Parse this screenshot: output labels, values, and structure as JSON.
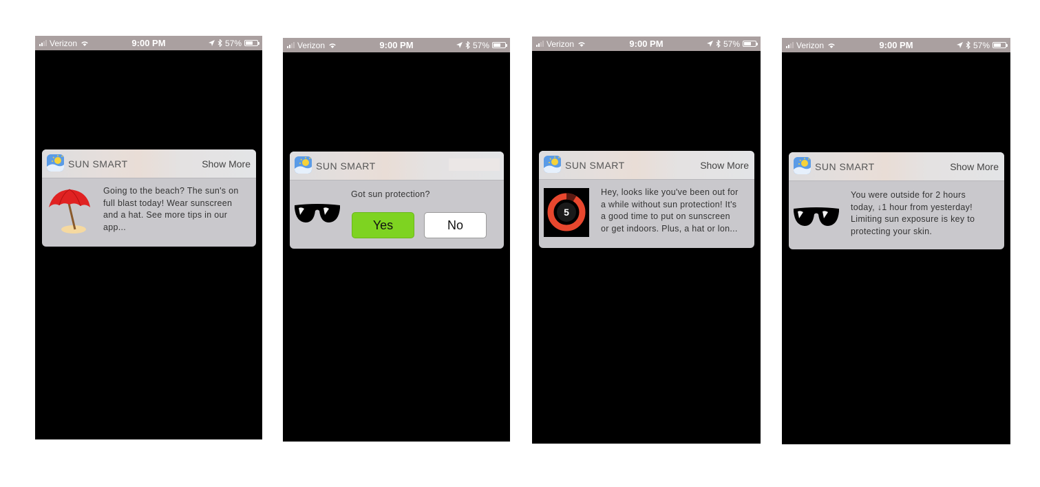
{
  "status_bar": {
    "carrier": "Verizon",
    "time": "9:00 PM",
    "battery": "57%",
    "battery_level": 0.57
  },
  "notification": {
    "app_name": "SUN SMART",
    "show_more_label": "Show More"
  },
  "screens": [
    {
      "icon": "beach-umbrella-icon",
      "message_lines": [
        "Going to the beach? The sun's on",
        "full blast today! Wear sunscreen",
        "and a hat. See more tips in our",
        "app..."
      ]
    },
    {
      "icon": "sunglasses-icon",
      "question": "Got sun protection?",
      "yes_label": "Yes",
      "no_label": "No"
    },
    {
      "icon": "countdown-ring-icon",
      "ring_value": "5",
      "message_lines": [
        "Hey, looks like you've been out for",
        "a while without sun protection! It's",
        "a good time to put on sunscreen",
        "or get indoors. Plus, a hat or lon..."
      ]
    },
    {
      "icon": "sunglasses-icon",
      "message_lines": [
        "You were outside for 2 hours",
        "today, ↓1 hour from yesterday!",
        "Limiting sun exposure is key to",
        "protecting your skin."
      ]
    }
  ],
  "colors": {
    "status_bar": "#aaa0a0",
    "yes_button": "#7ed321",
    "ring": "#e8472e",
    "umbrella": "#e02222"
  }
}
